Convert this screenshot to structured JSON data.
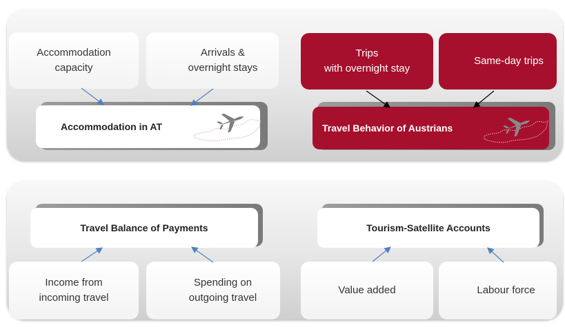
{
  "top_panel": {
    "accommodation_capacity": [
      "Accommodation",
      "capacity"
    ],
    "arrivals_stays": [
      "Arrivals &",
      "overnight stays"
    ],
    "accommodation_hub": "Accommodation in AT",
    "trips_overnight": [
      "Trips",
      "with overnight stay"
    ],
    "same_day_trips": "Same-day trips",
    "travel_behavior_hub": "Travel Behavior of Austrians"
  },
  "bottom_panel": {
    "travel_balance_hub": "Travel Balance of Payments",
    "income_incoming": [
      "Income from",
      "incoming travel"
    ],
    "spending_outgoing": [
      "Spending on",
      "outgoing travel"
    ],
    "tsa_hub": "Tourism-Satellite Accounts",
    "value_added": "Value added",
    "labour_force": "Labour force"
  },
  "colors": {
    "brand_red": "#a6102d",
    "arrow_blue": "#4f81bd",
    "arrow_black": "#000000"
  },
  "icons": [
    "austria-map-icon",
    "airplane-icon"
  ]
}
